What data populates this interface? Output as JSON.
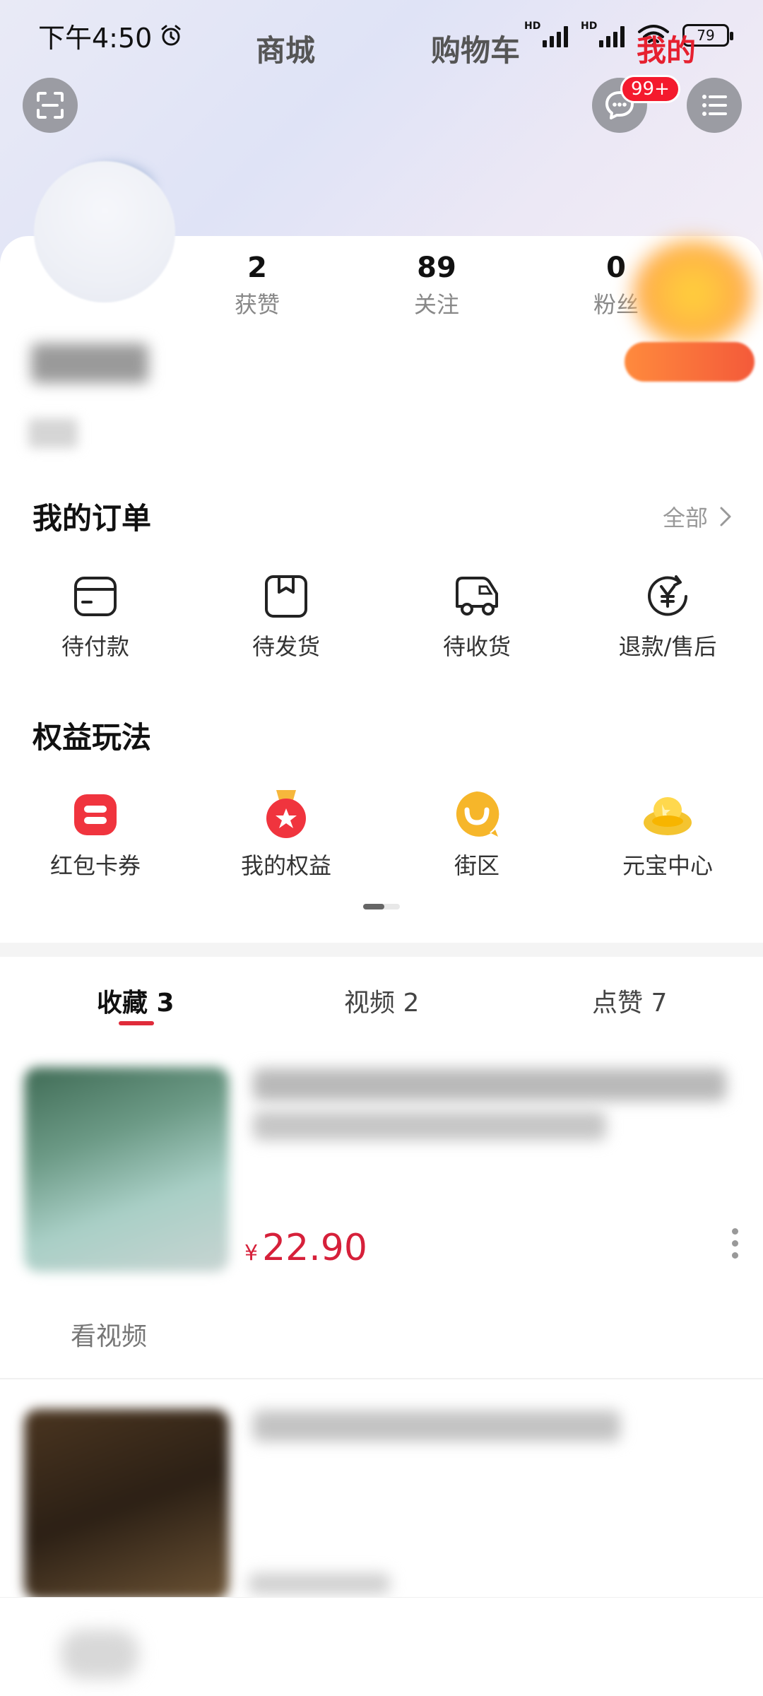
{
  "status_bar": {
    "time": "下午4:50",
    "battery": "79",
    "hd1": "HD",
    "hd2": "HD"
  },
  "header": {
    "message_badge": "99+",
    "scan_icon": "scan-icon",
    "message_icon": "chat-icon",
    "menu_icon": "list-menu-icon"
  },
  "profile": {
    "stats": [
      {
        "value": "2",
        "label": "获赞"
      },
      {
        "value": "89",
        "label": "关注"
      },
      {
        "value": "0",
        "label": "粉丝"
      }
    ]
  },
  "orders": {
    "title": "我的订单",
    "view_all": "全部",
    "items": [
      {
        "label": "待付款",
        "icon": "wallet-card-icon"
      },
      {
        "label": "待发货",
        "icon": "package-box-icon"
      },
      {
        "label": "待收货",
        "icon": "delivery-truck-icon"
      },
      {
        "label": "退款/售后",
        "icon": "refund-yen-icon"
      }
    ]
  },
  "benefits": {
    "title": "权益玩法",
    "items": [
      {
        "label": "红包卡券",
        "icon": "red-packet-icon"
      },
      {
        "label": "我的权益",
        "icon": "medal-star-icon"
      },
      {
        "label": "街区",
        "icon": "smile-bubble-icon"
      },
      {
        "label": "元宝中心",
        "icon": "gold-ingot-icon"
      }
    ]
  },
  "tabs": [
    {
      "label": "收藏 3",
      "active": true
    },
    {
      "label": "视频 2",
      "active": false
    },
    {
      "label": "点赞 7",
      "active": false
    }
  ],
  "products": [
    {
      "price_symbol": "¥",
      "price": "22.90",
      "watch_label": "看视频"
    }
  ],
  "bottom_nav": [
    {
      "label": "商城",
      "active": false
    },
    {
      "label": "购物车",
      "active": false
    },
    {
      "label": "我的",
      "active": true
    }
  ],
  "colors": {
    "accent": "#e6202f",
    "price": "#d6203a",
    "badge": "#f41a2d"
  }
}
